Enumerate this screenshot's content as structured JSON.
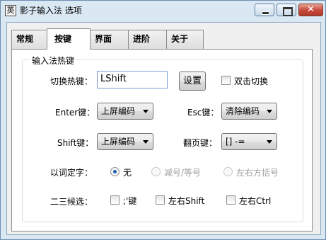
{
  "window": {
    "title": "影子输入法 选项",
    "icon_glyph": "英",
    "close_glyph": "✕"
  },
  "tabs": [
    {
      "label": "常规",
      "active": false
    },
    {
      "label": "按键",
      "active": true
    },
    {
      "label": "界面",
      "active": false
    },
    {
      "label": "进阶",
      "active": false
    },
    {
      "label": "关于",
      "active": false
    }
  ],
  "hotkey_group": {
    "title": "输入法热键",
    "switch_hotkey": {
      "label": "切换热键：",
      "value": "LShift",
      "set_button": "设置",
      "double_click_label": "双击切换",
      "double_click_checked": false
    },
    "enter_key": {
      "label": "Enter键：",
      "value": "上屏编码"
    },
    "esc_key": {
      "label": "Esc键：",
      "value": "清除编码"
    },
    "shift_key": {
      "label": "Shift键：",
      "value": "上屏编码"
    },
    "page_key": {
      "label": "翻页键：",
      "value": "[] -="
    },
    "word_select": {
      "label": "以词定字：",
      "options": [
        {
          "label": "无",
          "checked": true,
          "enabled": true
        },
        {
          "label": "减号/等号",
          "checked": false,
          "enabled": false
        },
        {
          "label": "左右方括号",
          "checked": false,
          "enabled": false
        }
      ]
    },
    "candidate_23": {
      "label": "二三候选：",
      "options": [
        {
          "label": ";'键",
          "checked": false
        },
        {
          "label": "左右Shift",
          "checked": false
        },
        {
          "label": "左右Ctrl",
          "checked": false
        }
      ]
    }
  }
}
